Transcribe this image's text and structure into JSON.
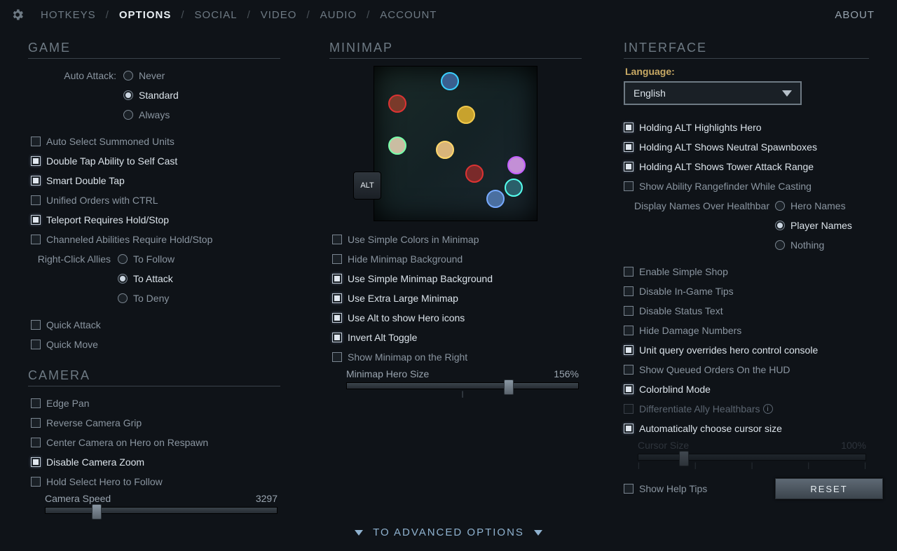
{
  "nav": {
    "items": [
      "HOTKEYS",
      "OPTIONS",
      "SOCIAL",
      "VIDEO",
      "AUDIO",
      "ACCOUNT"
    ],
    "active": 1,
    "right": "ABOUT"
  },
  "game": {
    "title": "GAME",
    "auto_attack_label": "Auto Attack:",
    "auto_attack_options": [
      "Never",
      "Standard",
      "Always"
    ],
    "auto_attack_selected": 1,
    "checks": [
      {
        "label": "Auto Select Summoned Units",
        "checked": false
      },
      {
        "label": "Double Tap Ability to Self Cast",
        "checked": true
      },
      {
        "label": "Smart Double Tap",
        "checked": true
      },
      {
        "label": "Unified Orders with CTRL",
        "checked": false
      },
      {
        "label": "Teleport Requires Hold/Stop",
        "checked": true
      },
      {
        "label": "Channeled Abilities Require Hold/Stop",
        "checked": false
      }
    ],
    "right_click_label": "Right-Click Allies",
    "right_click_options": [
      "To Follow",
      "To Attack",
      "To Deny"
    ],
    "right_click_selected": 1,
    "extra_checks": [
      {
        "label": "Quick Attack",
        "checked": false
      },
      {
        "label": "Quick Move",
        "checked": false
      }
    ]
  },
  "camera": {
    "title": "CAMERA",
    "checks": [
      {
        "label": "Edge Pan",
        "checked": false
      },
      {
        "label": "Reverse Camera Grip",
        "checked": false
      },
      {
        "label": "Center Camera on Hero on Respawn",
        "checked": false
      },
      {
        "label": "Disable Camera Zoom",
        "checked": true
      },
      {
        "label": "Hold Select Hero to Follow",
        "checked": false
      }
    ],
    "speed_label": "Camera Speed",
    "speed_value": "3297",
    "speed_pct": 22
  },
  "minimap": {
    "title": "MINIMAP",
    "alt_key": "ALT",
    "checks": [
      {
        "label": "Use Simple Colors in Minimap",
        "checked": false
      },
      {
        "label": "Hide Minimap Background",
        "checked": false
      },
      {
        "label": "Use Simple Minimap Background",
        "checked": true
      },
      {
        "label": "Use Extra Large Minimap",
        "checked": true
      },
      {
        "label": "Use Alt to show Hero icons",
        "checked": true
      },
      {
        "label": "Invert Alt Toggle",
        "checked": true
      },
      {
        "label": "Show Minimap on the Right",
        "checked": false
      }
    ],
    "hero_size_label": "Minimap Hero Size",
    "hero_size_value": "156%",
    "hero_size_pct": 70
  },
  "interface": {
    "title": "INTERFACE",
    "lang_label": "Language:",
    "lang_value": "English",
    "checks_a": [
      {
        "label": "Holding ALT Highlights Hero",
        "checked": true
      },
      {
        "label": "Holding ALT Shows Neutral Spawnboxes",
        "checked": true
      },
      {
        "label": "Holding ALT Shows Tower Attack Range",
        "checked": true
      },
      {
        "label": "Show Ability Rangefinder While Casting",
        "checked": false
      }
    ],
    "display_names_label": "Display Names Over Healthbar",
    "display_names_options": [
      "Hero Names",
      "Player Names",
      "Nothing"
    ],
    "display_names_selected": 1,
    "checks_b": [
      {
        "label": "Enable Simple Shop",
        "checked": false
      },
      {
        "label": "Disable In-Game Tips",
        "checked": false
      },
      {
        "label": "Disable Status Text",
        "checked": false
      },
      {
        "label": "Hide Damage Numbers",
        "checked": false
      },
      {
        "label": "Unit query overrides hero control console",
        "checked": true
      },
      {
        "label": "Show Queued Orders On the HUD",
        "checked": false
      },
      {
        "label": "Colorblind Mode",
        "checked": true
      }
    ],
    "diff_healthbars": "Differentiate Ally Healthbars",
    "auto_cursor": {
      "label": "Automatically choose cursor size",
      "checked": true
    },
    "cursor_size_label": "Cursor Size",
    "cursor_size_value": "100%",
    "cursor_size_pct": 20,
    "show_help": {
      "label": "Show Help Tips",
      "checked": false
    },
    "reset": "RESET"
  },
  "advanced": "TO ADVANCED OPTIONS"
}
